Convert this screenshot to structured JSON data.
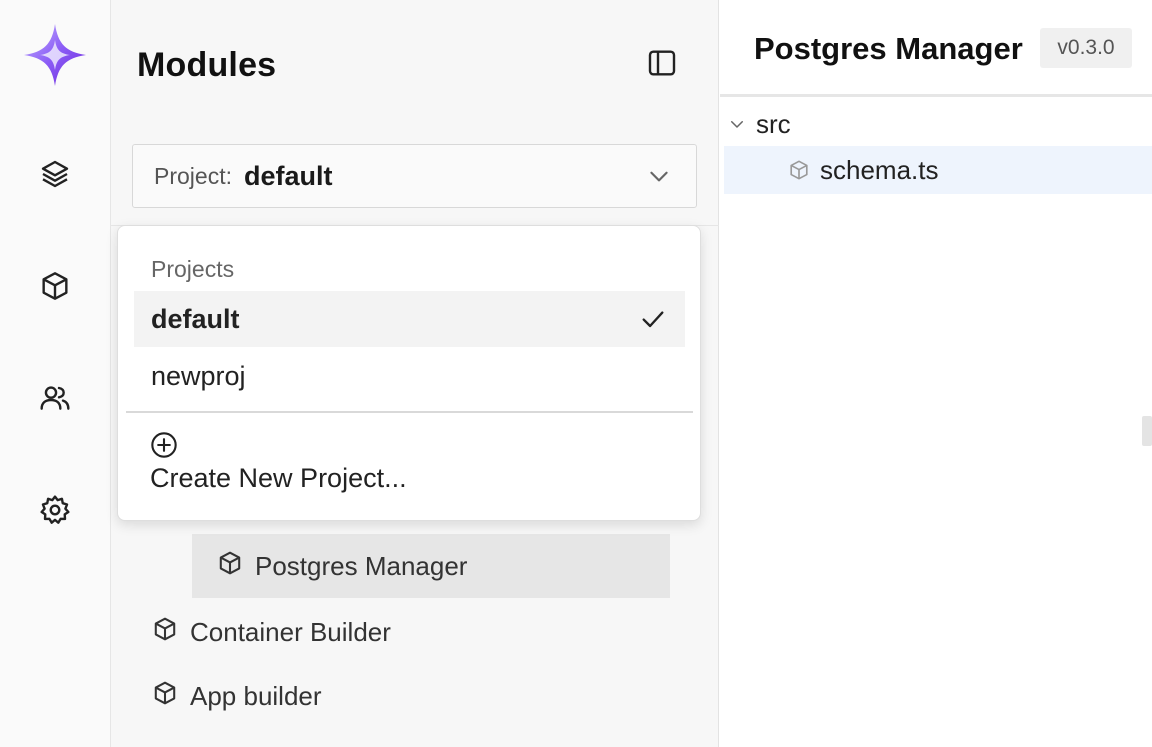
{
  "activity_bar": {
    "items": [
      {
        "icon": "layers-icon"
      },
      {
        "icon": "cube-icon"
      },
      {
        "icon": "users-icon"
      },
      {
        "icon": "gear-icon"
      }
    ]
  },
  "sidebar": {
    "title": "Modules",
    "project_select": {
      "label": "Project:",
      "value": "default"
    },
    "modules": [
      {
        "label": "Postgres Manager",
        "active": true
      },
      {
        "label": "Container Builder",
        "active": false
      },
      {
        "label": "App builder",
        "active": false
      }
    ]
  },
  "dropdown": {
    "heading": "Projects",
    "items": [
      {
        "label": "default",
        "selected": true
      },
      {
        "label": "newproj",
        "selected": false
      }
    ],
    "create_label": "Create New Project..."
  },
  "main": {
    "title": "Postgres Manager",
    "version": "v0.3.0",
    "tree": {
      "folder": "src",
      "file": "schema.ts"
    }
  },
  "colors": {
    "accent": "#8b5cf6",
    "selected_file_bg": "#eef4fd"
  }
}
